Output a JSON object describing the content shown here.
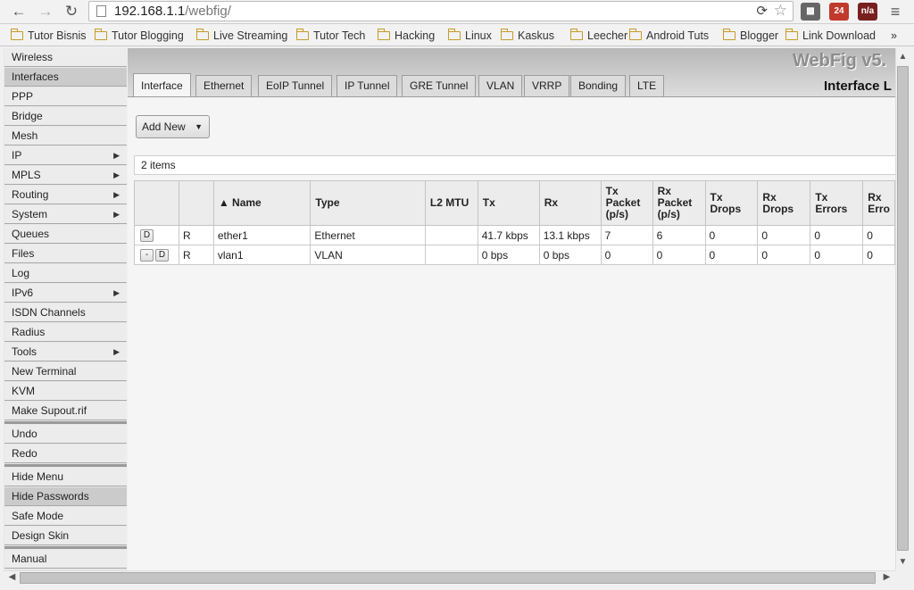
{
  "browser": {
    "url_host": "192.168.1.1",
    "url_path": "/webfig/",
    "bookmarks": [
      "Tutor Bisnis",
      "Tutor Blogging",
      "Live Streaming",
      "Tutor Tech",
      "Hacking",
      "Linux",
      "Kaskus",
      "Leecher",
      "Android Tuts",
      "Blogger",
      "Link Download"
    ],
    "more_label": "»",
    "ext1_label": "24",
    "ext2_label": "n/a"
  },
  "sidebar": {
    "items": [
      {
        "label": "Wireless"
      },
      {
        "label": "Interfaces",
        "selected": true
      },
      {
        "label": "PPP"
      },
      {
        "label": "Bridge"
      },
      {
        "label": "Mesh"
      },
      {
        "label": "IP",
        "submenu": true
      },
      {
        "label": "MPLS",
        "submenu": true
      },
      {
        "label": "Routing",
        "submenu": true
      },
      {
        "label": "System",
        "submenu": true
      },
      {
        "label": "Queues"
      },
      {
        "label": "Files"
      },
      {
        "label": "Log"
      },
      {
        "label": "IPv6",
        "submenu": true
      },
      {
        "label": "ISDN Channels"
      },
      {
        "label": "Radius"
      },
      {
        "label": "Tools",
        "submenu": true
      },
      {
        "label": "New Terminal"
      },
      {
        "label": "KVM"
      },
      {
        "label": "Make Supout.rif"
      }
    ],
    "group2": [
      {
        "label": "Undo"
      },
      {
        "label": "Redo"
      }
    ],
    "group3": [
      {
        "label": "Hide Menu"
      },
      {
        "label": "Hide Passwords",
        "selected": true
      },
      {
        "label": "Safe Mode"
      },
      {
        "label": "Design Skin"
      }
    ],
    "group4": [
      {
        "label": "Manual"
      }
    ],
    "submenu_arrow": "▶"
  },
  "header": {
    "logo": "WebFig v5.",
    "page_title": "Interface L"
  },
  "tabs": [
    "Interface",
    "Ethernet",
    "EoIP Tunnel",
    "IP Tunnel",
    "GRE Tunnel",
    "VLAN",
    "VRRP",
    "Bonding",
    "LTE"
  ],
  "toolbar": {
    "add_new_label": "Add New",
    "dropdown_glyph": "▼"
  },
  "item_count": "2 items",
  "table": {
    "columns": [
      "",
      "",
      "▲ Name",
      "Type",
      "L2 MTU",
      "Tx",
      "Rx",
      "Tx\nPacket\n(p/s)",
      "Rx\nPacket\n(p/s)",
      "Tx\nDrops",
      "Rx\nDrops",
      "Tx\nErrors",
      "Rx\nErro"
    ],
    "rows": [
      {
        "buttons": [
          "D"
        ],
        "flag": "R",
        "name": "ether1",
        "type": "Ethernet",
        "l2mtu": "",
        "tx": "41.7 kbps",
        "rx": "13.1 kbps",
        "tx_pps": "7",
        "rx_pps": "6",
        "tx_drops": "0",
        "rx_drops": "0",
        "tx_errors": "0",
        "rx_errors": "0"
      },
      {
        "buttons": [
          "-",
          "D"
        ],
        "flag": "R",
        "name": "vlan1",
        "type": "VLAN",
        "l2mtu": "",
        "tx": "0 bps",
        "rx": "0 bps",
        "tx_pps": "0",
        "rx_pps": "0",
        "tx_drops": "0",
        "rx_drops": "0",
        "tx_errors": "0",
        "rx_errors": "0"
      }
    ]
  }
}
